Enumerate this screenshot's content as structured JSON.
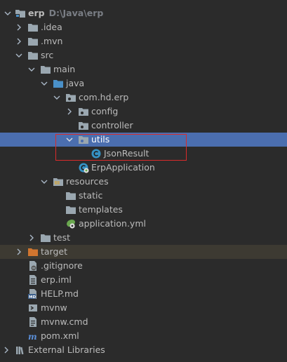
{
  "project": {
    "name": "erp",
    "path": "D:\\Java\\erp"
  },
  "tree": {
    "idea": ".idea",
    "mvn": ".mvn",
    "src": "src",
    "main": "main",
    "java": "java",
    "package": "com.hd.erp",
    "config": "config",
    "controller": "controller",
    "utils": "utils",
    "json_result": "JsonResult",
    "erp_application": "ErpApplication",
    "resources": "resources",
    "static": "static",
    "templates": "templates",
    "application_yml": "application.yml",
    "test": "test",
    "target": "target",
    "gitignore": ".gitignore",
    "erp_iml": "erp.iml",
    "help_md": "HELP.md",
    "mvnw": "mvnw",
    "mvnw_cmd": "mvnw.cmd",
    "pom_xml": "pom.xml",
    "external_libraries": "External Libraries"
  },
  "colors": {
    "background": "#2b2b2b",
    "selection": "#4b6eaf",
    "highlight_border": "#d92b2b",
    "folder": "#9aa7b0",
    "source_folder": "#4a90c8",
    "excluded_folder": "#d0752f",
    "class_icon": "#3592c4"
  }
}
